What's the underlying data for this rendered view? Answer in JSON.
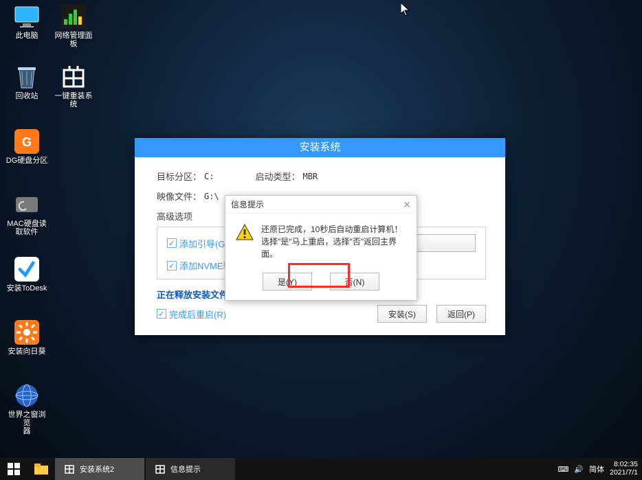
{
  "desktop": {
    "icons": [
      {
        "name": "this-pc",
        "label": "此电脑"
      },
      {
        "name": "net-panel",
        "label": "网络管理面板"
      },
      {
        "name": "recycle-bin",
        "label": "回收站"
      },
      {
        "name": "one-key",
        "label": "一键重装系统"
      },
      {
        "name": "dg",
        "label": "DG硬盘分区"
      },
      {
        "name": "mac-hd",
        "label": "MAC硬盘读\n取软件"
      },
      {
        "name": "todesk",
        "label": "安装ToDesk"
      },
      {
        "name": "sunflower",
        "label": "安装向日葵"
      },
      {
        "name": "browser",
        "label": "世界之窗浏览\n器"
      }
    ]
  },
  "window": {
    "title": "安装系统",
    "target_label": "目标分区：",
    "target_value": "C:",
    "boot_label": "启动类型：",
    "boot_value": "MBR",
    "image_label": "映像文件：",
    "image_value": "G:\\",
    "adv_header": "高级选项",
    "chk_boot": "添加引导(G):",
    "chk_nvme": "添加NVME驱",
    "releasing": "正在释放安装文件",
    "chk_restart": "完成后重启(R)",
    "btn_install": "安装(S)",
    "btn_back": "返回(P)"
  },
  "modal": {
    "title": "信息提示",
    "line1": "还原已完成，10秒后自动重启计算机！",
    "line2": "选择\"是\"马上重启，选择\"否\"返回主界面。",
    "btn_yes": "是(Y)",
    "btn_no": "否(N)"
  },
  "taskbar": {
    "task1": "安装系统2",
    "task2": "信息提示",
    "ime1": "⌨",
    "ime2": "简体",
    "time": "8:02:35",
    "date": "2021/7/1"
  }
}
